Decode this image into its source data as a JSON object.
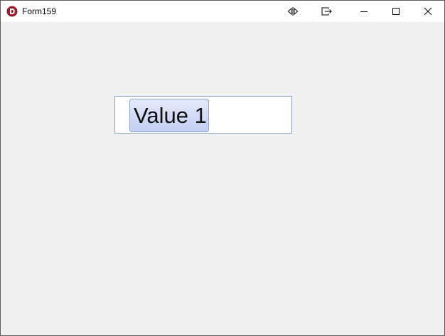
{
  "window": {
    "title": "Form159"
  },
  "titlebar": {
    "icons": [
      "delphi-app-icon",
      "mirror-icon",
      "goto-icon",
      "minimize-icon",
      "maximize-icon",
      "close-icon"
    ]
  },
  "tag_editor": {
    "tags": [
      {
        "label": "Value 1"
      }
    ],
    "text_value": ""
  },
  "colors": {
    "client_background": "#f0f0f0",
    "titlebar_background": "#ffffff",
    "editor_border": "#8aa5c4",
    "chip_gradient_top": "#e4eafa",
    "chip_gradient_bottom": "#c3cff4",
    "chip_border": "#8fa5d6",
    "app_icon_red": "#9b1c2e"
  }
}
